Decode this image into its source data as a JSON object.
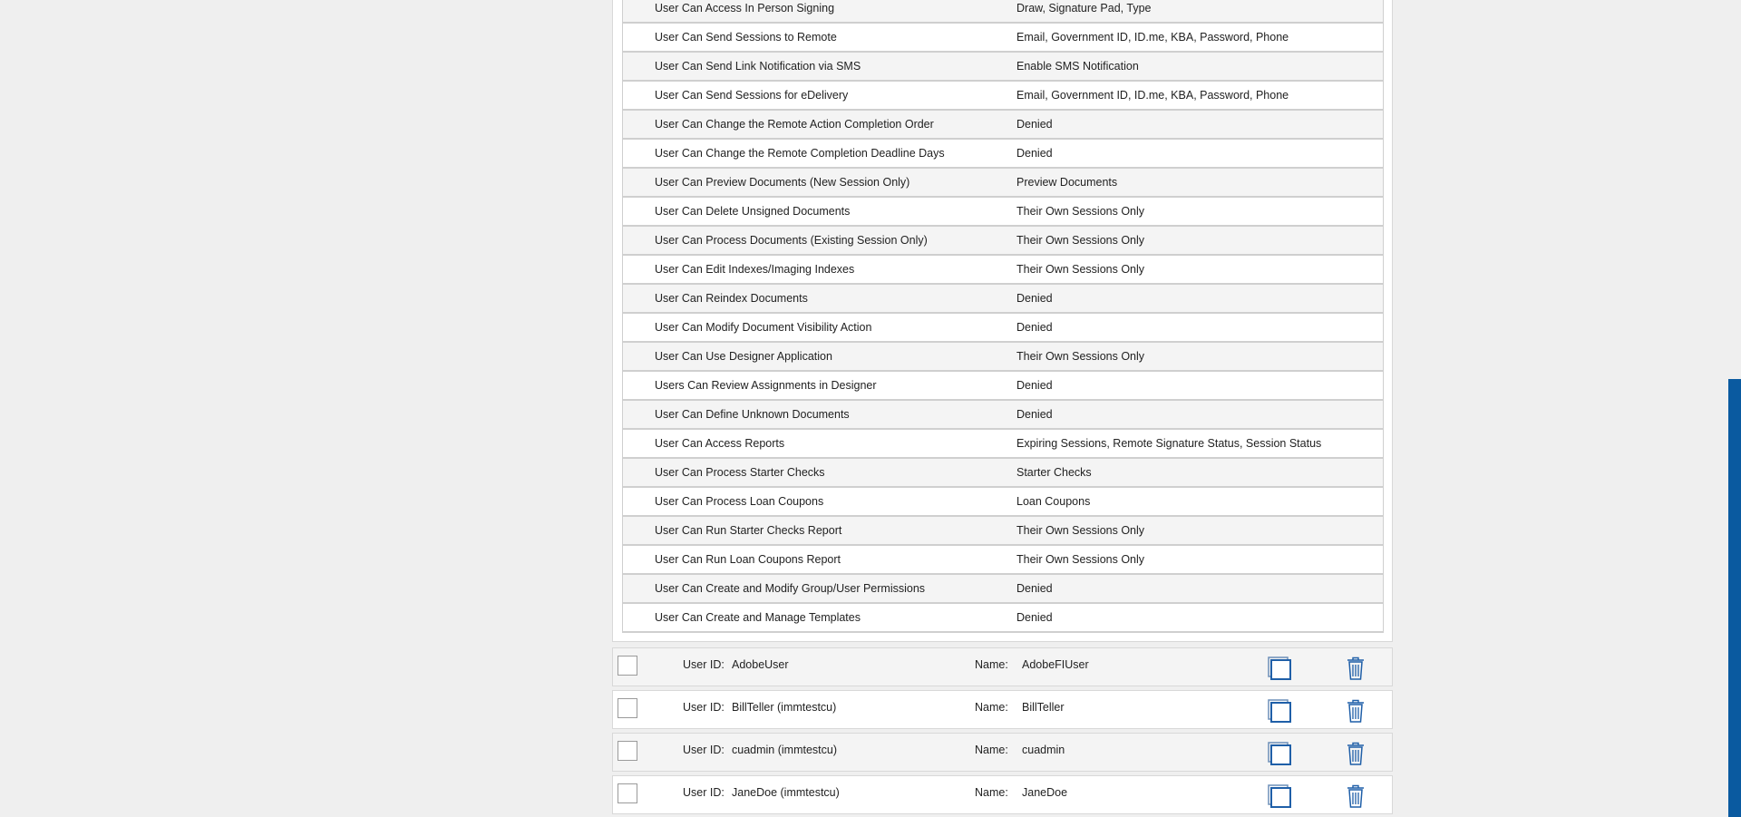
{
  "permissions": [
    {
      "name": "User Can Access In Person Signing",
      "value": "Draw, Signature Pad, Type"
    },
    {
      "name": "User Can Send Sessions to Remote",
      "value": "Email, Government ID, ID.me, KBA, Password, Phone"
    },
    {
      "name": "User Can Send Link Notification via SMS",
      "value": "Enable SMS Notification"
    },
    {
      "name": "User Can Send Sessions for eDelivery",
      "value": "Email, Government ID, ID.me, KBA, Password, Phone"
    },
    {
      "name": "User Can Change the Remote Action Completion Order",
      "value": "Denied"
    },
    {
      "name": "User Can Change the Remote Completion Deadline Days",
      "value": "Denied"
    },
    {
      "name": "User Can Preview Documents (New Session Only)",
      "value": "Preview Documents"
    },
    {
      "name": "User Can Delete Unsigned Documents",
      "value": "Their Own Sessions Only"
    },
    {
      "name": "User Can Process Documents (Existing Session Only)",
      "value": "Their Own Sessions Only"
    },
    {
      "name": "User Can Edit Indexes/Imaging Indexes",
      "value": "Their Own Sessions Only"
    },
    {
      "name": "User Can Reindex Documents",
      "value": "Denied"
    },
    {
      "name": "User Can Modify Document Visibility Action",
      "value": "Denied"
    },
    {
      "name": "User Can Use Designer Application",
      "value": "Their Own Sessions Only"
    },
    {
      "name": "Users Can Review Assignments in Designer",
      "value": "Denied"
    },
    {
      "name": "User Can Define Unknown Documents",
      "value": "Denied"
    },
    {
      "name": "User Can Access Reports",
      "value": "Expiring Sessions, Remote Signature Status, Session Status"
    },
    {
      "name": "User Can Process Starter Checks",
      "value": "Starter Checks"
    },
    {
      "name": "User Can Process Loan Coupons",
      "value": "Loan Coupons"
    },
    {
      "name": "User Can Run Starter Checks Report",
      "value": "Their Own Sessions Only"
    },
    {
      "name": "User Can Run Loan Coupons Report",
      "value": "Their Own Sessions Only"
    },
    {
      "name": "User Can Create and Modify Group/User Permissions",
      "value": "Denied"
    },
    {
      "name": "User Can Create and Manage Templates",
      "value": "Denied"
    }
  ],
  "users": {
    "user_id_label": "User ID:",
    "name_label": "Name:",
    "rows": [
      {
        "user_id": "AdobeUser",
        "name": "AdobeFIUser"
      },
      {
        "user_id": "BillTeller (immtestcu)",
        "name": "BillTeller"
      },
      {
        "user_id": "cuadmin (immtestcu)",
        "name": "cuadmin"
      },
      {
        "user_id": "JaneDoe (immtestcu)",
        "name": "JaneDoe"
      }
    ]
  },
  "colors": {
    "accent": "#1f5fa8",
    "scrollbar": "#0a5aa0",
    "row_alt": "#f4f4f4",
    "border": "#cfcfcf"
  },
  "icons": {
    "copy": "copy-icon",
    "delete": "trash-icon"
  }
}
